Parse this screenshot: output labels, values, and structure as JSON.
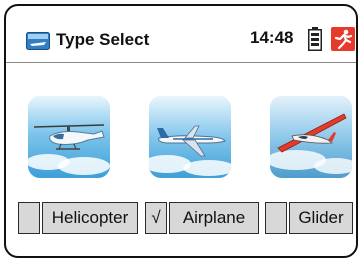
{
  "header": {
    "title": "Type Select",
    "time": "14:48",
    "icons": [
      "model-icon",
      "battery-icon",
      "runner-icon"
    ]
  },
  "options": [
    {
      "label": "Helicopter",
      "checked": false,
      "check_mark": "",
      "icon": "helicopter-icon"
    },
    {
      "label": "Airplane",
      "checked": true,
      "check_mark": "√",
      "icon": "airplane-icon"
    },
    {
      "label": "Glider",
      "checked": false,
      "check_mark": "",
      "icon": "glider-icon"
    }
  ],
  "colors": {
    "option_bg": "#d8d8d8",
    "sky": "#4aa6dc",
    "runner_bg": "#e63a2b"
  }
}
